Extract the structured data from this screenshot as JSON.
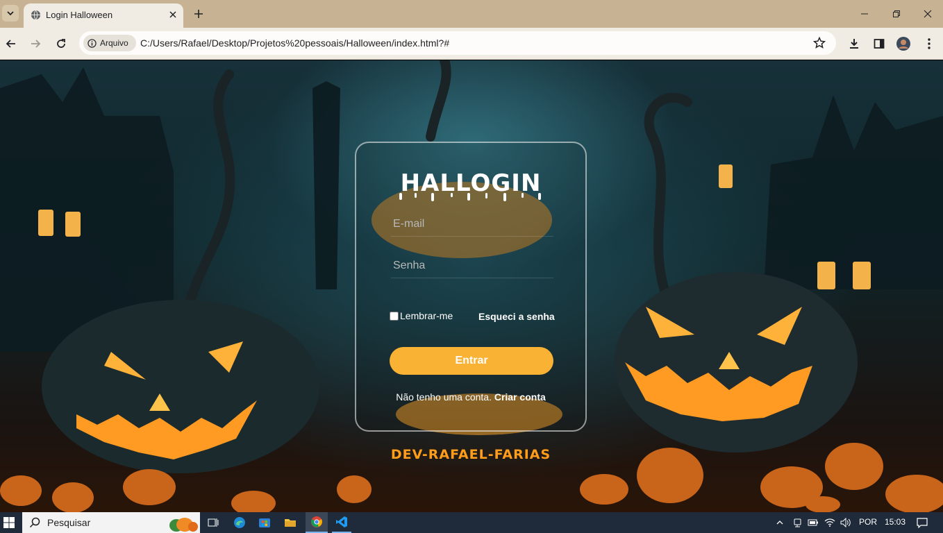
{
  "browser": {
    "tab": {
      "title": "Login Halloween"
    },
    "address": {
      "security_chip": "Arquivo",
      "url": "C:/Users/Rafael/Desktop/Projetos%20pessoais/Halloween/index.html?#"
    }
  },
  "page": {
    "brand": "HALLOGIN",
    "email_placeholder": "E-mail",
    "password_placeholder": "Senha",
    "remember_label": "Lembrar-me",
    "forgot_link": "Esqueci a senha",
    "submit_label": "Entrar",
    "signup_text": "Não tenho uma conta.",
    "signup_link": "Criar conta",
    "footer_credit": "DEV-RAFAEL-FARIAS",
    "accent_color": "#f9b233"
  },
  "taskbar": {
    "search_placeholder": "Pesquisar",
    "language": "POR",
    "clock": "15:03"
  }
}
